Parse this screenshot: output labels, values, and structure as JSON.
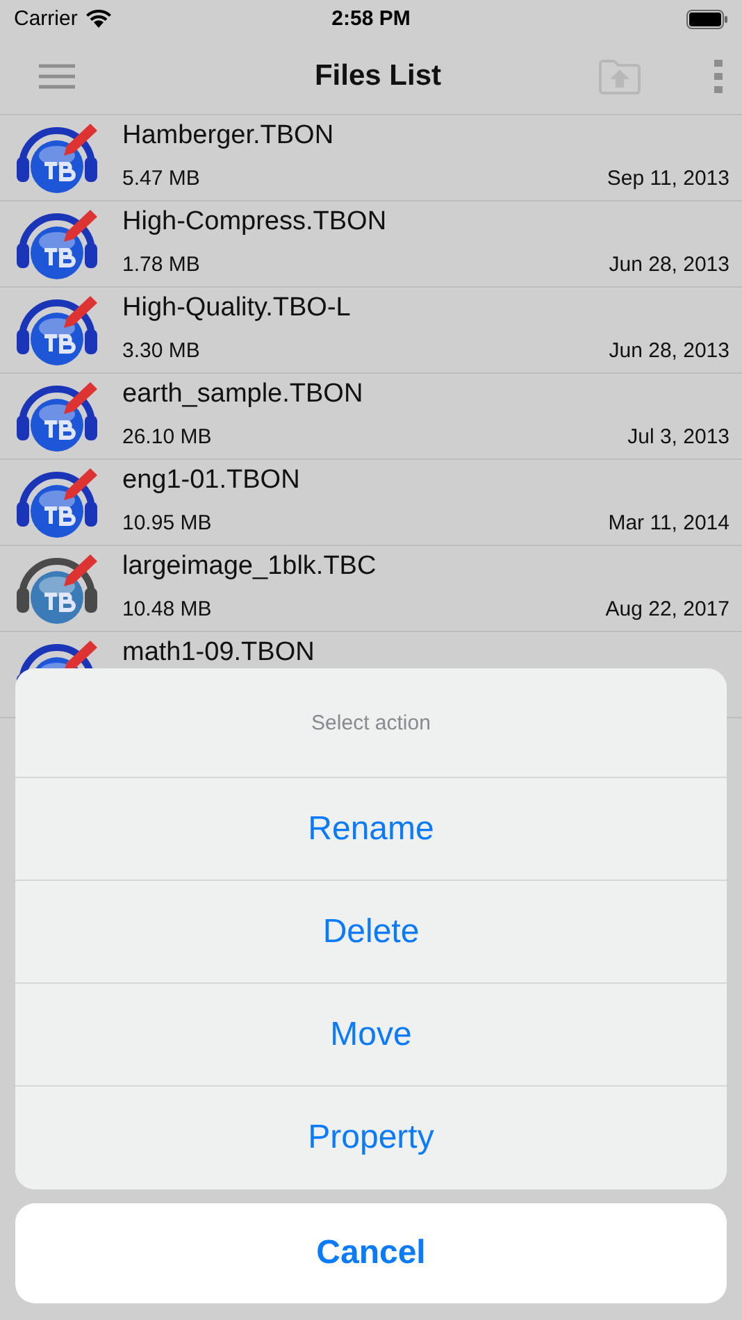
{
  "status_bar": {
    "carrier": "Carrier",
    "time": "2:58 PM"
  },
  "nav_bar": {
    "title": "Files List"
  },
  "files": [
    {
      "name": "Hamberger.TBON",
      "size": "5.47 MB",
      "date": "Sep 11, 2013",
      "kind": "tbon"
    },
    {
      "name": "High-Compress.TBON",
      "size": "1.78 MB",
      "date": "Jun 28, 2013",
      "kind": "tbon"
    },
    {
      "name": "High-Quality.TBO-L",
      "size": "3.30 MB",
      "date": "Jun 28, 2013",
      "kind": "tbon"
    },
    {
      "name": "earth_sample.TBON",
      "size": "26.10 MB",
      "date": "Jul 3, 2013",
      "kind": "tbon"
    },
    {
      "name": "eng1-01.TBON",
      "size": "10.95 MB",
      "date": "Mar 11, 2014",
      "kind": "tbon"
    },
    {
      "name": "largeimage_1blk.TBC",
      "size": "10.48 MB",
      "date": "Aug 22, 2017",
      "kind": "tbc"
    },
    {
      "name": "math1-09.TBON",
      "kind": "tbon"
    }
  ],
  "action_sheet": {
    "title": "Select action",
    "actions": [
      "Rename",
      "Delete",
      "Move",
      "Property"
    ],
    "cancel": "Cancel"
  }
}
